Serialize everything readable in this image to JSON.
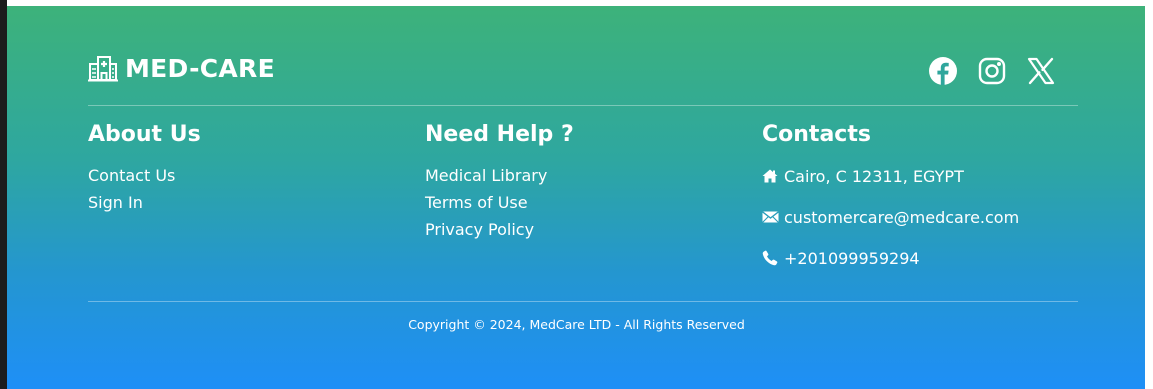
{
  "brand": {
    "name": "MED-CARE",
    "icon": "hospital-icon"
  },
  "social": [
    {
      "name": "facebook",
      "icon": "facebook-icon"
    },
    {
      "name": "instagram",
      "icon": "instagram-icon"
    },
    {
      "name": "x",
      "icon": "x-icon"
    }
  ],
  "columns": {
    "about": {
      "title": "About Us",
      "links": [
        "Contact Us",
        "Sign In"
      ]
    },
    "help": {
      "title": "Need Help ?",
      "links": [
        "Medical Library",
        "Terms of Use",
        "Privacy Policy"
      ]
    },
    "contacts": {
      "title": "Contacts",
      "items": [
        {
          "icon": "home-icon",
          "text": "Cairo, C 12311, EGYPT"
        },
        {
          "icon": "envelope-icon",
          "text": "customercare@medcare.com"
        },
        {
          "icon": "phone-icon",
          "text": "+201099959294"
        }
      ]
    }
  },
  "copyright": "Copyright © 2024, MedCare LTD - All Rights Reserved",
  "colors": {
    "gradient_top": "#3db27a",
    "gradient_bottom": "#1e8ff7",
    "text": "#ffffff"
  }
}
